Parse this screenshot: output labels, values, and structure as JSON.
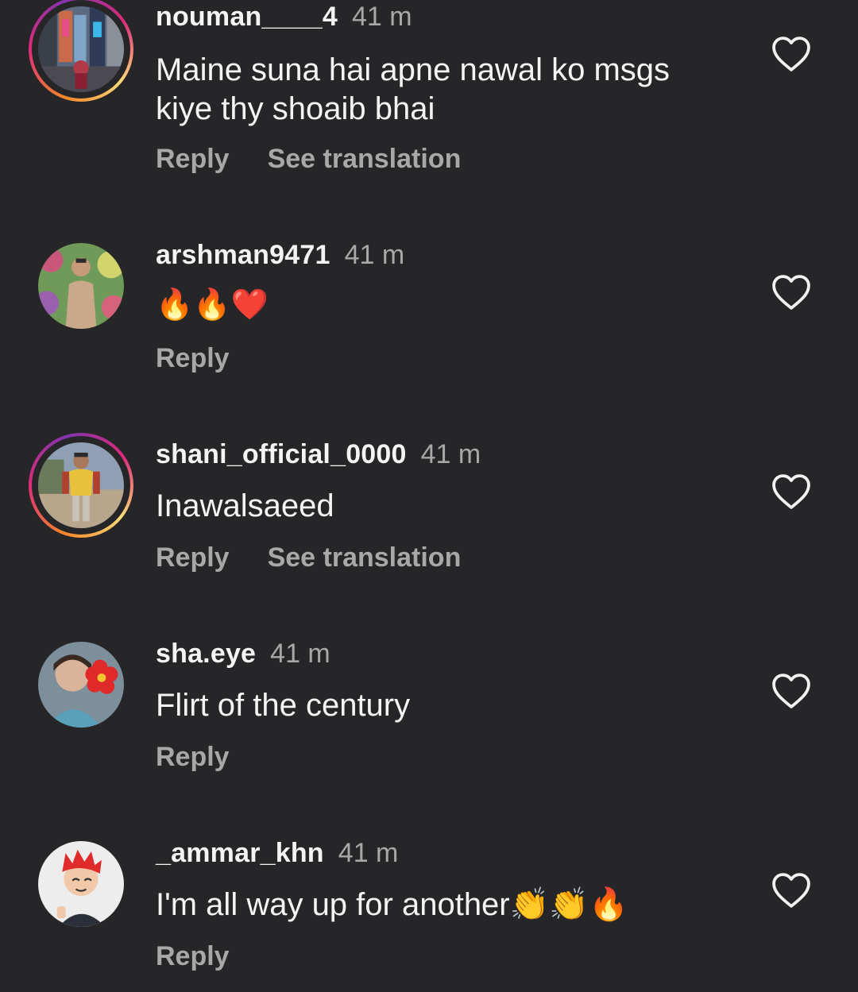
{
  "comments": [
    {
      "username": "nouman____4",
      "time": "41 m",
      "text": "Maine suna hai apne nawal ko msgs kiye thy shoaib bhai",
      "actions": [
        "Reply",
        "See translation"
      ],
      "avatar_icon": "city-street-avatar-icon",
      "story_ring": true
    },
    {
      "username": "arshman9471",
      "time": "41 m",
      "text": "🔥🔥❤️",
      "actions": [
        "Reply"
      ],
      "avatar_icon": "person-flowers-avatar-icon",
      "story_ring": false
    },
    {
      "username": "shani_official_0000",
      "time": "41 m",
      "text": "Inawalsaeed",
      "actions": [
        "Reply",
        "See translation"
      ],
      "avatar_icon": "person-yellow-shirt-avatar-icon",
      "story_ring": true
    },
    {
      "username": "sha.eye",
      "time": "41 m",
      "text": "Flirt of the century",
      "actions": [
        "Reply"
      ],
      "avatar_icon": "child-red-flower-avatar-icon",
      "story_ring": false
    },
    {
      "username": "_ammar_khn",
      "time": "41 m",
      "text": "I'm all way up for another👏👏🔥",
      "actions": [
        "Reply"
      ],
      "avatar_icon": "cartoon-avatar-icon",
      "story_ring": false
    }
  ],
  "colors": {
    "background": "#262628",
    "primary_text": "#f4f4f4",
    "secondary_text": "#a8a8a8"
  },
  "like_icon": "heart-outline-icon"
}
